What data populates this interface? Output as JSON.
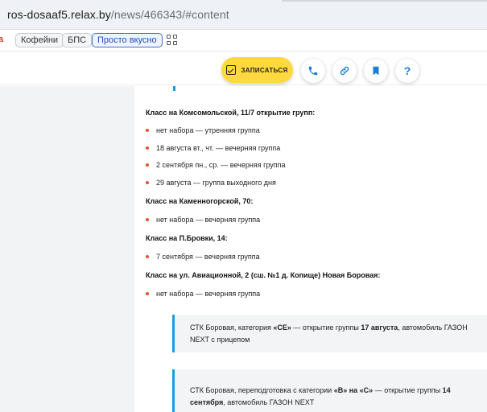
{
  "browser": {
    "url_host": "ros-dosaaf5.relax.by",
    "url_path": "/news/466343/#content"
  },
  "bookmarks": {
    "partial_label": "а",
    "items": [
      "Кофейни",
      "БПС",
      "Просто вкусно"
    ]
  },
  "toolbar": {
    "enroll_label": "ЗАПИСАТЬСЯ",
    "help_label": "?"
  },
  "article": {
    "class1": {
      "heading": "Класс на Комсомольской, 11/7 открытие групп:",
      "items": [
        "нет набора — утренняя группа",
        "18 августа вт., чт. — вечерняя группа",
        "2 сентября пн., ср. — вечерняя группа",
        "29 августа — группа выходного дня"
      ]
    },
    "class2": {
      "heading": "Класс на Каменногорской, 70:",
      "items": [
        "нет набора — вечерняя группа"
      ]
    },
    "class3": {
      "heading": "Класс на П.Бровки, 14:",
      "items": [
        "7 сентября — вечерняя группа"
      ]
    },
    "class4": {
      "heading": "Класс на ул. Авиационной, 2 (сш. №1 д. Копище) Новая Боровая:",
      "items": [
        "нет набора — вечерняя группа"
      ]
    },
    "quote1": {
      "t1": "СТК Боровая, категория ",
      "b1": "«СЕ»",
      "t2": " — открытие группы ",
      "b2": "17 августа",
      "t3": ", автомобиль ГАЗОН",
      "t4": "NEXT с прицепом"
    },
    "quote2": {
      "t1": "СТК Боровая, переподготовка с категории ",
      "b1": "«В» на «С»",
      "t2": " — открытие группы ",
      "b2": "14",
      "b3": "сентября",
      "t3": ", автомобиль ГАЗОН NEXT"
    }
  },
  "colors": {
    "accent_yellow": "#ffd93d",
    "accent_blue": "#1c7fd6",
    "bullet_orange": "#e7522a",
    "quote_border": "#1c9ce0"
  }
}
